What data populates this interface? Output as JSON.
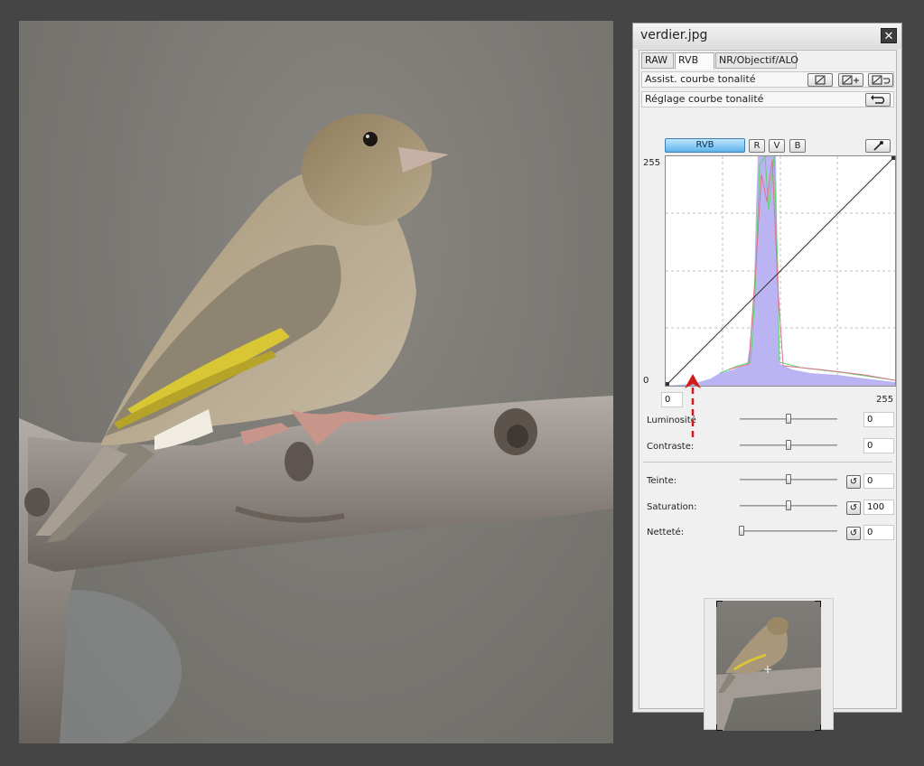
{
  "window": {
    "title": "verdier.jpg",
    "close_glyph": "✕"
  },
  "tabs": [
    {
      "label": "RAW",
      "active": false
    },
    {
      "label": "RVB",
      "active": true
    },
    {
      "label": "NR/Objectif/ALO",
      "active": false
    }
  ],
  "curve_assist": {
    "label": "Assist. courbe tonalité"
  },
  "curve_adjust": {
    "label": "Réglage courbe tonalité"
  },
  "channels": {
    "rvb": "RVB",
    "r": "R",
    "v": "V",
    "b": "B"
  },
  "graph": {
    "y_top": "255",
    "y_bottom": "0",
    "input_low": "0",
    "input_high": "255"
  },
  "sliders": {
    "luminosite": {
      "label": "Luminosité",
      "value": "0",
      "level": 0.5
    },
    "contraste": {
      "label": "Contraste:",
      "value": "0",
      "level": 0.5
    },
    "teinte": {
      "label": "Teinte:",
      "value": "0",
      "level": 0.5
    },
    "saturation": {
      "label": "Saturation:",
      "value": "100",
      "level": 0.5
    },
    "nettete": {
      "label": "Netteté:",
      "value": "0",
      "level": 0.0
    }
  },
  "colors": {
    "annotation_arrow": "#d11a1a",
    "active_channel": "#5eb3ea",
    "histogram_fill": "#b7b0f2"
  },
  "icons": [
    "curve-reset-icon",
    "curve-add-icon",
    "curve-undo-icon",
    "undo-icon",
    "eyedropper-icon",
    "close-icon"
  ]
}
